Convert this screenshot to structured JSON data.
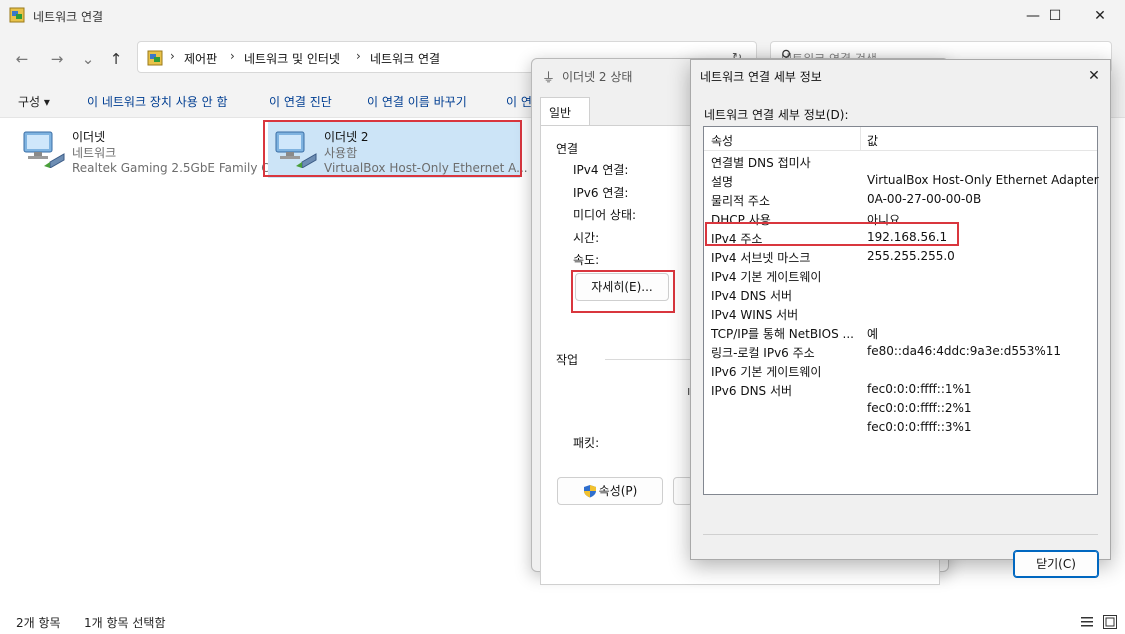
{
  "window": {
    "title": "네트워크 연결",
    "controls": {
      "minimize": "—",
      "maximize": "☐",
      "close": "✕"
    }
  },
  "nav": {
    "back": "←",
    "forward": "→",
    "dropdown": "⌄",
    "up": "↑"
  },
  "address": {
    "crumbs": [
      "제어판",
      "네트워크 및 인터넷",
      "네트워크 연결"
    ],
    "separator": "›",
    "refresh": "↻"
  },
  "search": {
    "placeholder": "네트워크 연결 검색",
    "icon": "⚲"
  },
  "commandbar": {
    "organize": "구성 ▾",
    "disable": "이 네트워크 장치 사용 안 함",
    "diagnose": "이 연결 진단",
    "rename": "이 연결 이름 바꾸기",
    "more": "이 연"
  },
  "adapters": [
    {
      "name": "이더넷",
      "status": "네트워크",
      "device": "Realtek Gaming 2.5GbE Family C..."
    },
    {
      "name": "이더넷 2",
      "status": "사용함",
      "device": "VirtualBox Host-Only Ethernet A..."
    }
  ],
  "statusbar": {
    "count": "2개 항목",
    "selected": "1개 항목 선택함"
  },
  "status_dialog": {
    "title": "이더넷 2 상태",
    "tab": "일반",
    "connection_group": "연결",
    "fields": [
      "IPv4 연결:",
      "IPv6 연결:",
      "미디어 상태:",
      "시간:",
      "속도:"
    ],
    "details_button": "자세히(E)...",
    "activity_group": "작업",
    "packets_label": "패킷:",
    "properties_button": "속성(P)"
  },
  "details_dialog": {
    "title": "네트워크 연결 세부 정보",
    "list_label": "네트워크 연결 세부 정보(D):",
    "columns": [
      "속성",
      "값"
    ],
    "rows": [
      {
        "k": "연결별 DNS 접미사",
        "v": ""
      },
      {
        "k": "설명",
        "v": "VirtualBox Host-Only Ethernet Adapter"
      },
      {
        "k": "물리적 주소",
        "v": "0A-00-27-00-00-0B"
      },
      {
        "k": "DHCP 사용",
        "v": "아니요"
      },
      {
        "k": "IPv4 주소",
        "v": "192.168.56.1"
      },
      {
        "k": "IPv4 서브넷 마스크",
        "v": "255.255.255.0"
      },
      {
        "k": "IPv4 기본 게이트웨이",
        "v": ""
      },
      {
        "k": "IPv4 DNS 서버",
        "v": ""
      },
      {
        "k": "IPv4 WINS 서버",
        "v": ""
      },
      {
        "k": "TCP/IP를 통해 NetBIOS ...",
        "v": "예"
      },
      {
        "k": "링크-로컬 IPv6 주소",
        "v": "fe80::da46:4ddc:9a3e:d553%11"
      },
      {
        "k": "IPv6 기본 게이트웨이",
        "v": ""
      },
      {
        "k": "IPv6 DNS 서버",
        "v": "fec0:0:0:ffff::1%1"
      },
      {
        "k": "",
        "v": "fec0:0:0:ffff::2%1"
      },
      {
        "k": "",
        "v": "fec0:0:0:ffff::3%1"
      }
    ],
    "close_button": "닫기(C)"
  },
  "colors": {
    "highlight": "#d9363e",
    "selection": "#cce4f7",
    "accent": "#0067c0",
    "link": "#003e92"
  }
}
